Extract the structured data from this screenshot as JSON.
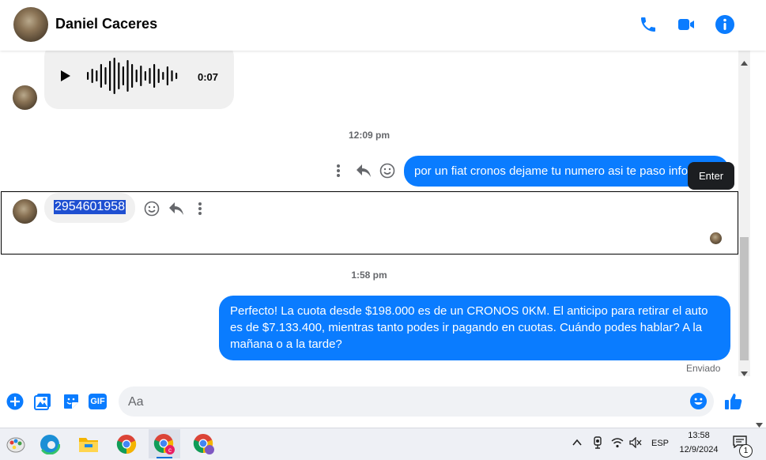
{
  "header": {
    "contact_name": "Daniel Caceres"
  },
  "icons": {
    "phone": "phone-icon",
    "video": "video-icon",
    "info": "info-icon"
  },
  "colors": {
    "accent": "#0a7cff",
    "incoming_bubble": "#f0f0f0",
    "selection": "#1e4fd1"
  },
  "messages": {
    "voice_duration": "0:07",
    "time_1": "12:09 pm",
    "outgoing_1": "por un fiat cronos dejame tu numero asi te paso info",
    "tooltip": "Enter",
    "incoming_number": "2954601958",
    "time_2": "1:58 pm",
    "outgoing_2": "Perfecto! La cuota desde $198.000 es de un CRONOS 0KM. El anticipo para retirar el auto es de $7.133.400, mientras tanto podes ir pagando en cuotas. Cuándo podes hablar? A la mañana o a la tarde?",
    "status": "Enviado"
  },
  "composer": {
    "placeholder": "Aa",
    "gif_label": "GIF"
  },
  "taskbar": {
    "language": "ESP",
    "time": "13:58",
    "date": "12/9/2024",
    "notification_count": "1"
  }
}
